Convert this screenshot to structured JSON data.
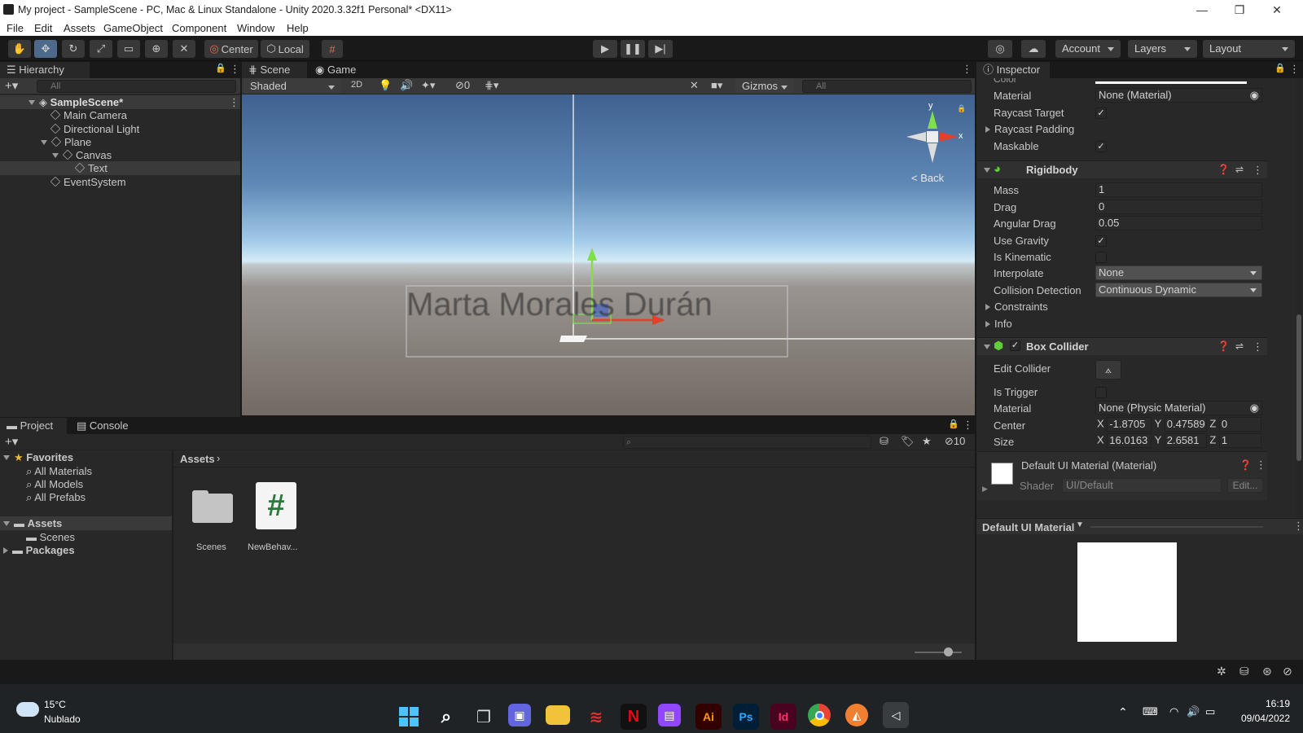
{
  "window": {
    "title": "My project - SampleScene - PC, Mac & Linux Standalone - Unity 2020.3.32f1 Personal* <DX11>",
    "minimize": "—",
    "maximize": "❐",
    "close": "✕"
  },
  "menu": [
    "File",
    "Edit",
    "Assets",
    "GameObject",
    "Component",
    "Window",
    "Help"
  ],
  "toolbar": {
    "pivot": "Center",
    "space": "Local",
    "account": "Account",
    "layers": "Layers",
    "layout": "Layout"
  },
  "hierarchy": {
    "tab": "Hierarchy",
    "search_placeholder": "All",
    "scene": "SampleScene*",
    "items": [
      "Main Camera",
      "Directional Light",
      "Plane",
      "Canvas",
      "Text",
      "EventSystem"
    ]
  },
  "scene_view": {
    "tab_scene": "Scene",
    "tab_game": "Game",
    "shading": "Shaded",
    "mode2d": "2D",
    "hidden_count": "0",
    "gizmos": "Gizmos",
    "search_placeholder": "All",
    "gizmo_label": "< Back",
    "axis_x": "x",
    "axis_y": "y",
    "text_object": "Marta Morales Durán"
  },
  "project": {
    "tab_project": "Project",
    "tab_console": "Console",
    "favorites": "Favorites",
    "fav_items": [
      "All Materials",
      "All Models",
      "All Prefabs"
    ],
    "assets": "Assets",
    "assets_child": "Scenes",
    "packages": "Packages",
    "breadcrumb": "Assets",
    "files": [
      {
        "name": "Scenes",
        "icon": "folder-icon"
      },
      {
        "name": "NewBehav...",
        "icon": "csharp-script-icon",
        "glyph": "#"
      }
    ],
    "hidden_count": "10",
    "zoom_level": 0.7
  },
  "inspector": {
    "tab": "Inspector",
    "partial_label": "Color",
    "image": {
      "material_label": "Material",
      "material_value": "None (Material)",
      "raycast_target": "Raycast Target",
      "raycast_padding": "Raycast Padding",
      "maskable": "Maskable"
    },
    "rigidbody": {
      "title": "Rigidbody",
      "mass_label": "Mass",
      "mass": "1",
      "drag_label": "Drag",
      "drag": "0",
      "angular_drag_label": "Angular Drag",
      "angular_drag": "0.05",
      "use_gravity_label": "Use Gravity",
      "is_kinematic_label": "Is Kinematic",
      "interpolate_label": "Interpolate",
      "interpolate": "None",
      "collision_label": "Collision Detection",
      "collision": "Continuous Dynamic",
      "constraints": "Constraints",
      "info": "Info"
    },
    "box_collider": {
      "title": "Box Collider",
      "edit_collider": "Edit Collider",
      "is_trigger": "Is Trigger",
      "material_label": "Material",
      "material": "None (Physic Material)",
      "center_label": "Center",
      "center": {
        "x": "-1.8705",
        "y": "0.47589",
        "z": "0"
      },
      "size_label": "Size",
      "size": {
        "x": "16.0163",
        "y": "2.6581",
        "z": "1"
      }
    },
    "material": {
      "name": "Default UI Material (Material)",
      "shader_label": "Shader",
      "shader": "UI/Default",
      "edit": "Edit...",
      "preview_title": "Default UI Material"
    }
  },
  "taskbar": {
    "temp": "15°C",
    "weather": "Nublado",
    "time": "16:19",
    "date": "09/04/2022"
  }
}
